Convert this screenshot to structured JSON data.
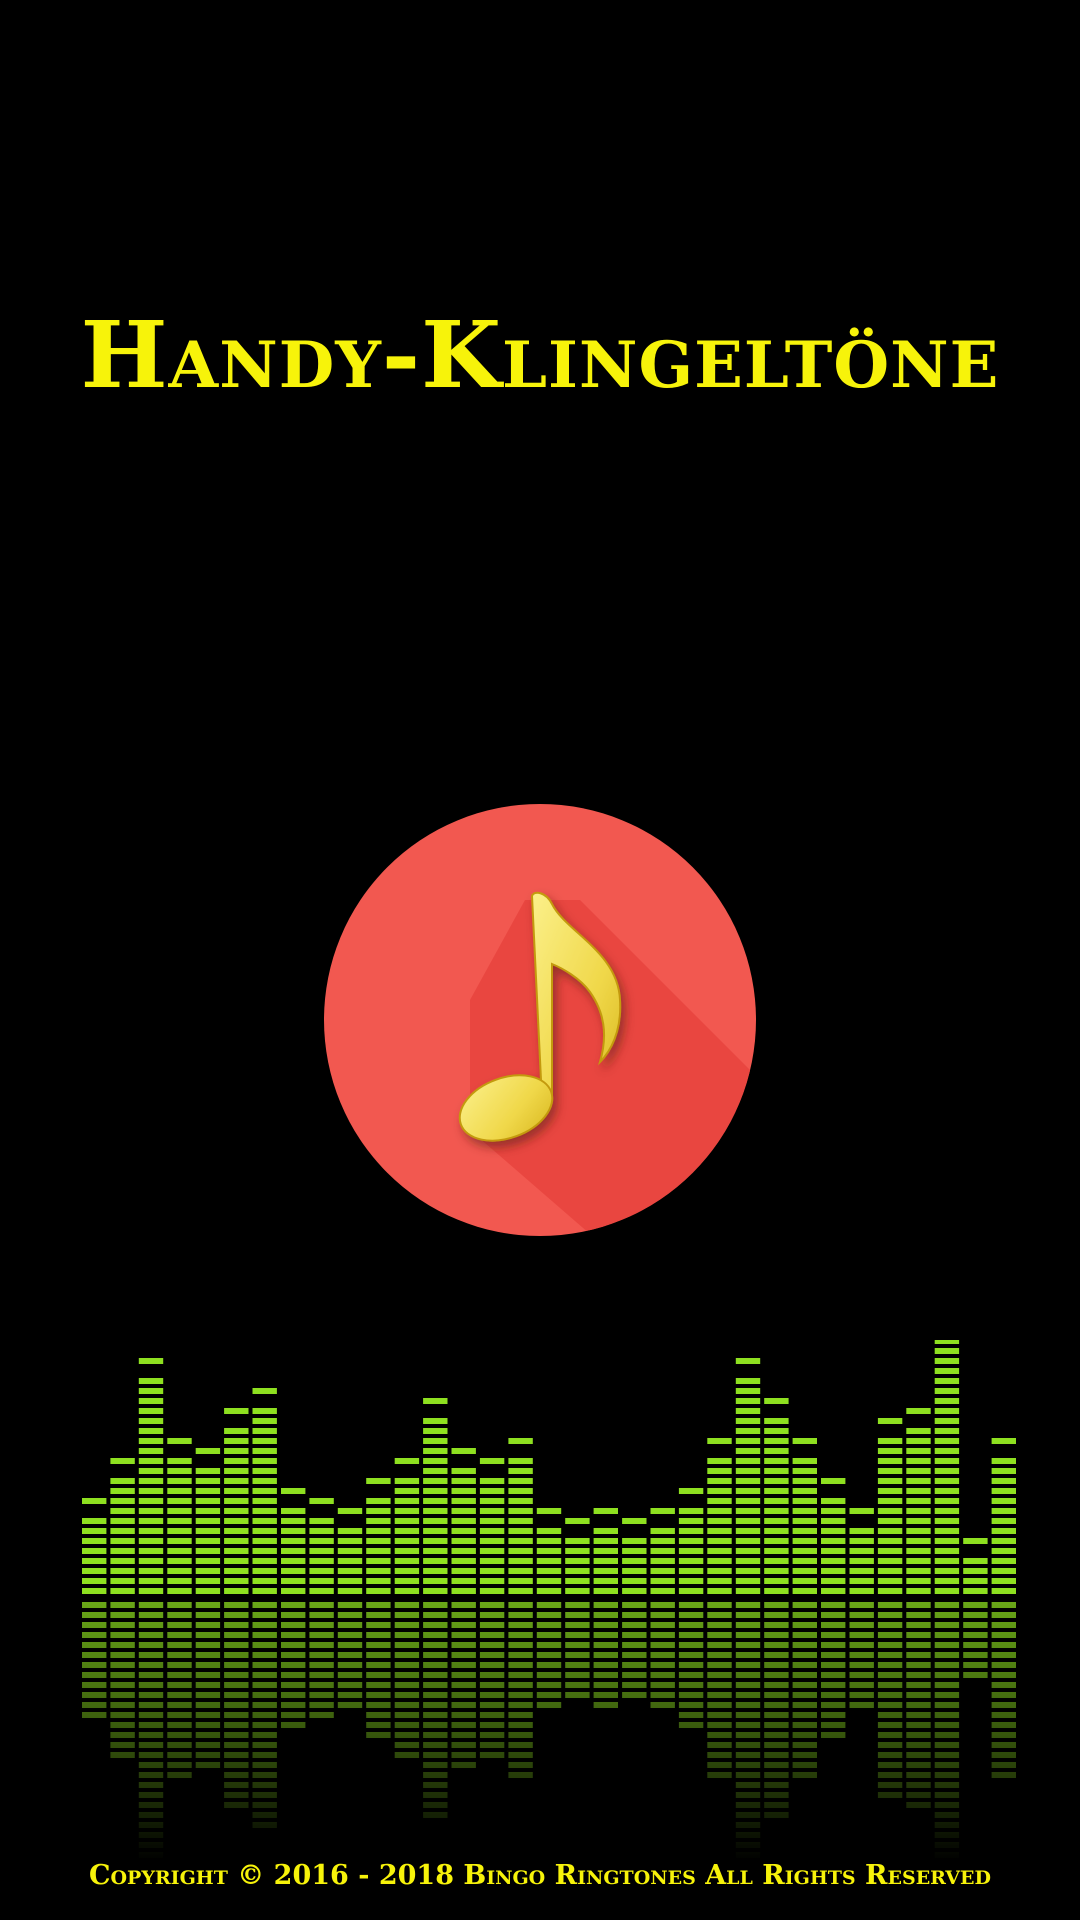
{
  "app": {
    "title": "Handy-Klingeltöne"
  },
  "logo": {
    "icon": "music-note-icon",
    "circle_color": "#f25850",
    "note_color": "#f3e46a"
  },
  "equalizer": {
    "icon": "equalizer-bars",
    "color": "#8ee020",
    "levels": [
      0.17,
      0.26,
      0.45,
      0.3,
      0.28,
      0.36,
      0.39,
      0.19,
      0.17,
      0.14,
      0.21,
      0.26,
      0.38,
      0.28,
      0.24,
      0.3,
      0.15,
      0.13,
      0.15,
      0.13,
      0.15,
      0.18,
      0.29,
      0.46,
      0.38,
      0.29,
      0.2,
      0.15,
      0.33,
      0.36,
      0.55,
      0.09,
      0.3
    ]
  },
  "footer": {
    "copyright": "Copyright © 2016 - 2018 Bingo Ringtones All Rights Reserved"
  }
}
